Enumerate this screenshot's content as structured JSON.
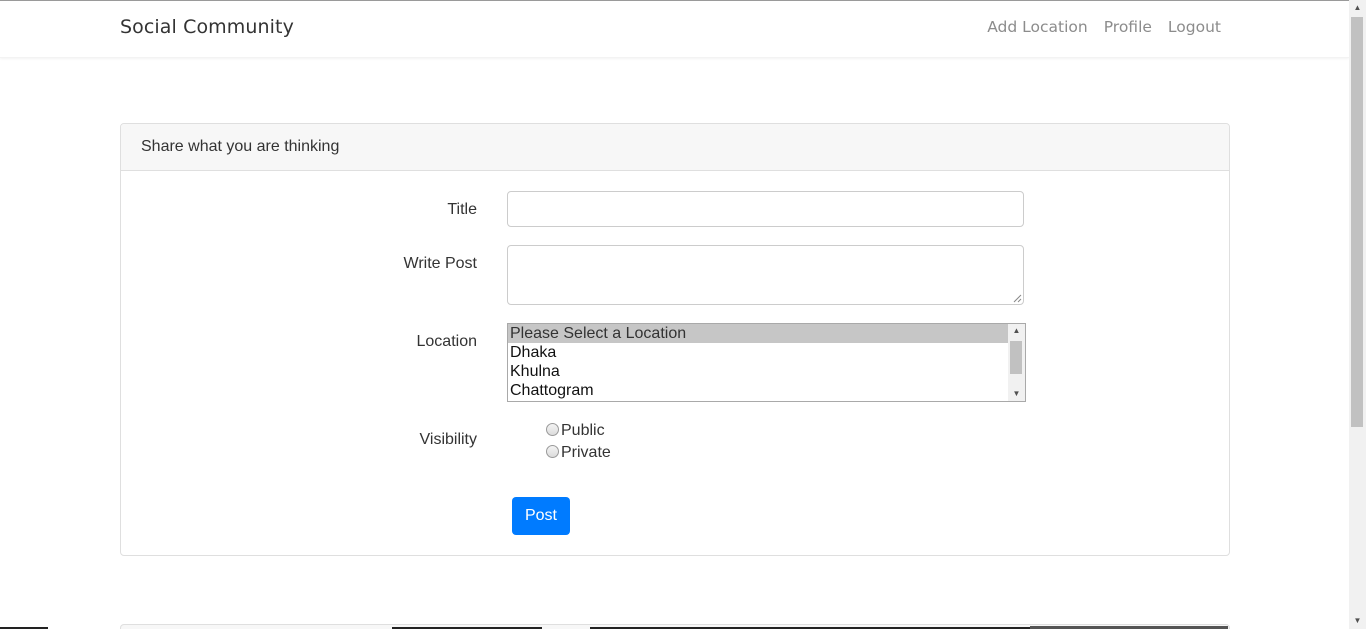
{
  "navbar": {
    "brand": "Social Community",
    "links": [
      "Add Location",
      "Profile",
      "Logout"
    ]
  },
  "card": {
    "header": "Share what you are thinking"
  },
  "form": {
    "title_label": "Title",
    "title_value": "",
    "post_label": "Write Post",
    "post_value": "",
    "location_label": "Location",
    "location_options": [
      "Please Select a Location",
      "Dhaka",
      "Khulna",
      "Chattogram"
    ],
    "location_selected": "Please Select a Location",
    "visibility_label": "Visibility",
    "visibility_options": [
      "Public",
      "Private"
    ],
    "submit_label": "Post"
  },
  "colors": {
    "primary_button": "#007bff",
    "nav_link": "#8c8c8c",
    "selected_option": "#c6c6c6"
  }
}
